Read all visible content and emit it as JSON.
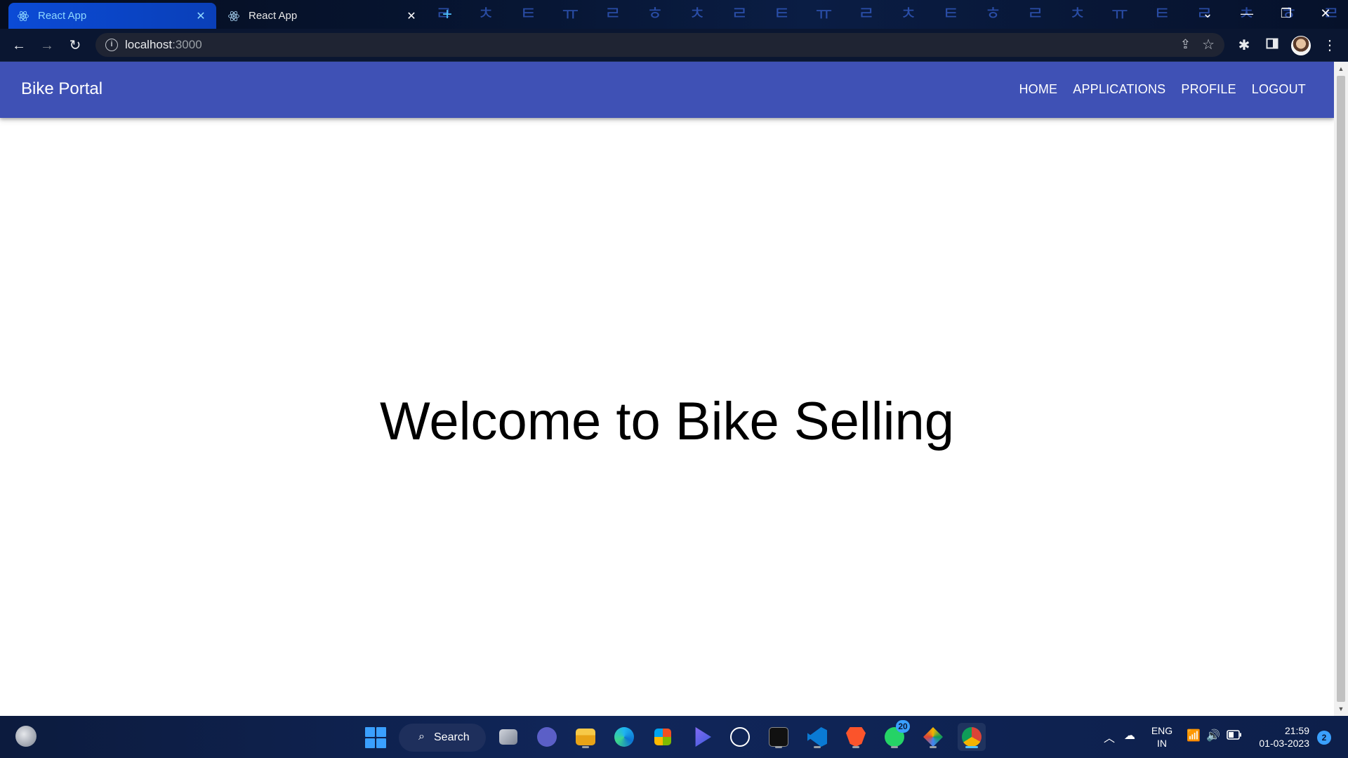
{
  "browser": {
    "tabs": [
      {
        "title": "React App",
        "active": true
      },
      {
        "title": "React App",
        "active": false
      }
    ],
    "new_tab_icon": "plus-icon",
    "address": {
      "host": "localhost",
      "port": ":3000"
    }
  },
  "page": {
    "brand": "Bike Portal",
    "nav": [
      "HOME",
      "APPLICATIONS",
      "PROFILE",
      "LOGOUT"
    ],
    "heading": "Welcome to Bike Selling",
    "appbar_color": "#3f51b5"
  },
  "taskbar": {
    "search_label": "Search",
    "whatsapp_badge": "20",
    "language": {
      "line1": "ENG",
      "line2": "IN"
    },
    "time": "21:59",
    "date": "01-03-2023",
    "notifications": "2"
  }
}
